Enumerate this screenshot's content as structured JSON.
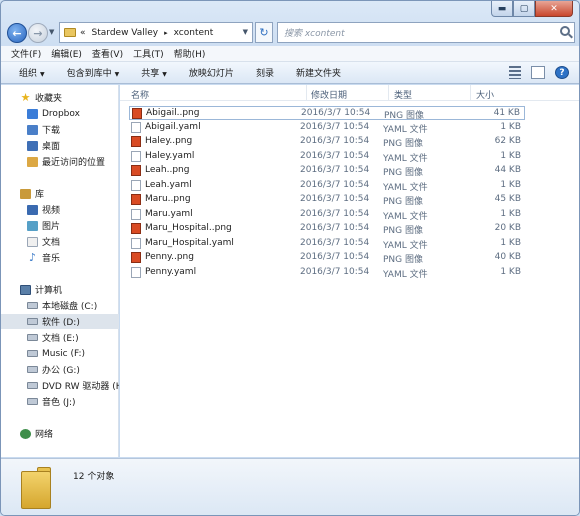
{
  "window": {
    "caption": {
      "minimize": "▬",
      "maximize": "▢",
      "close": "✕"
    },
    "back": "←",
    "forward": "→",
    "refresh": "↻"
  },
  "address": {
    "prefix": "«",
    "crumbs": [
      "Stardew Valley",
      "xcontent"
    ],
    "separator": "▸"
  },
  "search": {
    "placeholder": "搜索 xcontent"
  },
  "menu": [
    "文件(F)",
    "编辑(E)",
    "查看(V)",
    "工具(T)",
    "帮助(H)"
  ],
  "toolbar": [
    {
      "label": "组织",
      "dropdown": true
    },
    {
      "label": "包含到库中",
      "dropdown": true
    },
    {
      "label": "共享",
      "dropdown": true
    },
    {
      "label": "放映幻灯片",
      "dropdown": false
    },
    {
      "label": "刻录",
      "dropdown": false
    },
    {
      "label": "新建文件夹",
      "dropdown": false
    }
  ],
  "nav": [
    {
      "label": "收藏夹",
      "icon": "star-icon",
      "cls": "ico-star",
      "glyph": "★",
      "indent": 0
    },
    {
      "label": "Dropbox",
      "icon": "dropbox-icon",
      "cls": "ico-dropbox",
      "indent": 1
    },
    {
      "label": "下载",
      "icon": "download-folder-icon",
      "cls": "ico-dl",
      "indent": 1
    },
    {
      "label": "桌面",
      "icon": "desktop-icon",
      "cls": "ico-desk",
      "indent": 1
    },
    {
      "label": "最近访问的位置",
      "icon": "recent-places-icon",
      "cls": "ico-recent",
      "indent": 1
    },
    {
      "label": "库",
      "icon": "library-icon",
      "cls": "ico-lib",
      "indent": 0
    },
    {
      "label": "视频",
      "icon": "video-icon",
      "cls": "ico-video",
      "indent": 1
    },
    {
      "label": "图片",
      "icon": "picture-icon",
      "cls": "ico-pic",
      "indent": 1
    },
    {
      "label": "文档",
      "icon": "document-icon",
      "cls": "ico-doc",
      "indent": 1
    },
    {
      "label": "音乐",
      "icon": "music-icon",
      "cls": "ico-music",
      "glyph": "♪",
      "indent": 1
    },
    {
      "label": "计算机",
      "icon": "computer-icon",
      "cls": "ico-pc",
      "indent": 0
    },
    {
      "label": "本地磁盘 (C:)",
      "icon": "drive-icon",
      "cls": "ico-drive",
      "indent": 1
    },
    {
      "label": "软件 (D:)",
      "icon": "drive-icon",
      "cls": "ico-drive",
      "indent": 1,
      "selected": true
    },
    {
      "label": "文档 (E:)",
      "icon": "drive-icon",
      "cls": "ico-drive",
      "indent": 1
    },
    {
      "label": "Music (F:)",
      "icon": "drive-icon",
      "cls": "ico-drive",
      "indent": 1
    },
    {
      "label": "办公 (G:)",
      "icon": "drive-icon",
      "cls": "ico-drive",
      "indent": 1
    },
    {
      "label": "DVD RW 驱动器 (H:",
      "icon": "dvd-drive-icon",
      "cls": "ico-drive",
      "indent": 1
    },
    {
      "label": "音色 (J:)",
      "icon": "drive-icon",
      "cls": "ico-drive",
      "indent": 1
    },
    {
      "label": "网络",
      "icon": "network-icon",
      "cls": "ico-net",
      "indent": 0
    }
  ],
  "columns": {
    "name": "名称",
    "date": "修改日期",
    "type": "类型",
    "size": "大小"
  },
  "files": [
    {
      "name": "Abigail..png",
      "date": "2016/3/7 10:54",
      "type": "PNG 图像",
      "size": "41 KB",
      "kind": "png",
      "selected": true
    },
    {
      "name": "Abigail.yaml",
      "date": "2016/3/7 10:54",
      "type": "YAML 文件",
      "size": "1 KB",
      "kind": "yaml"
    },
    {
      "name": "Haley..png",
      "date": "2016/3/7 10:54",
      "type": "PNG 图像",
      "size": "62 KB",
      "kind": "png"
    },
    {
      "name": "Haley.yaml",
      "date": "2016/3/7 10:54",
      "type": "YAML 文件",
      "size": "1 KB",
      "kind": "yaml"
    },
    {
      "name": "Leah..png",
      "date": "2016/3/7 10:54",
      "type": "PNG 图像",
      "size": "44 KB",
      "kind": "png"
    },
    {
      "name": "Leah.yaml",
      "date": "2016/3/7 10:54",
      "type": "YAML 文件",
      "size": "1 KB",
      "kind": "yaml"
    },
    {
      "name": "Maru..png",
      "date": "2016/3/7 10:54",
      "type": "PNG 图像",
      "size": "45 KB",
      "kind": "png"
    },
    {
      "name": "Maru.yaml",
      "date": "2016/3/7 10:54",
      "type": "YAML 文件",
      "size": "1 KB",
      "kind": "yaml"
    },
    {
      "name": "Maru_Hospital..png",
      "date": "2016/3/7 10:54",
      "type": "PNG 图像",
      "size": "20 KB",
      "kind": "png"
    },
    {
      "name": "Maru_Hospital.yaml",
      "date": "2016/3/7 10:54",
      "type": "YAML 文件",
      "size": "1 KB",
      "kind": "yaml"
    },
    {
      "name": "Penny..png",
      "date": "2016/3/7 10:54",
      "type": "PNG 图像",
      "size": "40 KB",
      "kind": "png"
    },
    {
      "name": "Penny.yaml",
      "date": "2016/3/7 10:54",
      "type": "YAML 文件",
      "size": "1 KB",
      "kind": "yaml"
    }
  ],
  "details": {
    "count": "12 个对象"
  }
}
